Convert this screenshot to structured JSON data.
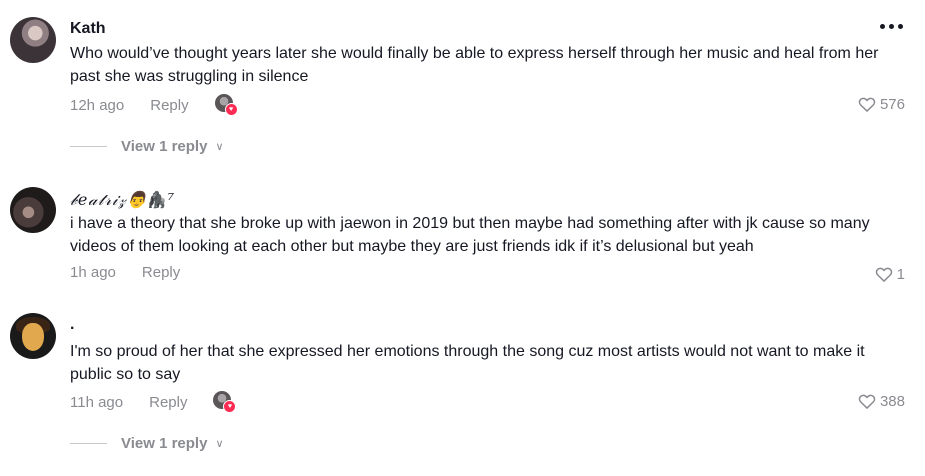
{
  "comments": [
    {
      "username": "Kath",
      "text": "Who would’ve thought years later she would finally be able to express herself through her music and heal from her past she was struggling in silence",
      "time": "12h ago",
      "reply_label": "Reply",
      "likes": "576",
      "creator_liked": true,
      "view_replies": "View 1 reply"
    },
    {
      "username": "𝒷𝑒𝒶𝓉𝓇𝒾𝓏👨‍🦍⁷",
      "text": "i have a theory that she broke up with jaewon in 2019 but then maybe had something after with jk cause so many videos of them looking at each other but maybe they are just friends idk if it’s delusional but yeah",
      "time": "1h ago",
      "reply_label": "Reply",
      "likes": "1",
      "creator_liked": false
    },
    {
      "username": ".",
      "text": "I'm so proud of her that she expressed her emotions through the song cuz most artists would not want to make it public so to say",
      "time": "11h ago",
      "reply_label": "Reply",
      "likes": "388",
      "creator_liked": true,
      "view_replies": "View 1 reply"
    }
  ],
  "icons": {
    "more": "more-dots-icon",
    "like": "heart-outline-icon",
    "chevron": "chevron-down-icon"
  }
}
